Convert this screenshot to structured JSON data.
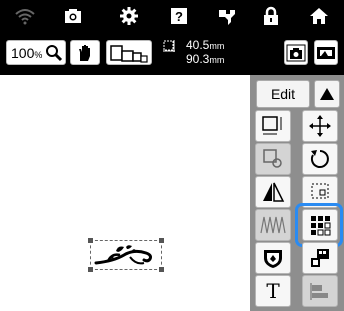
{
  "statusbar": {
    "icons": [
      "wifi-icon",
      "camera-icon",
      "settings-icon",
      "help-icon",
      "sewing-icon",
      "lock-icon",
      "home-icon"
    ]
  },
  "toolbar": {
    "zoom_value": "100",
    "zoom_unit": "%",
    "width_value": "40.5",
    "height_value": "90.3",
    "unit": "mm"
  },
  "panel": {
    "edit_label": "Edit",
    "text_label": "T"
  },
  "colors": {
    "bar_bg": "#000000",
    "panel_bg": "#8e8e8e",
    "highlight": "#2a8bf2"
  }
}
